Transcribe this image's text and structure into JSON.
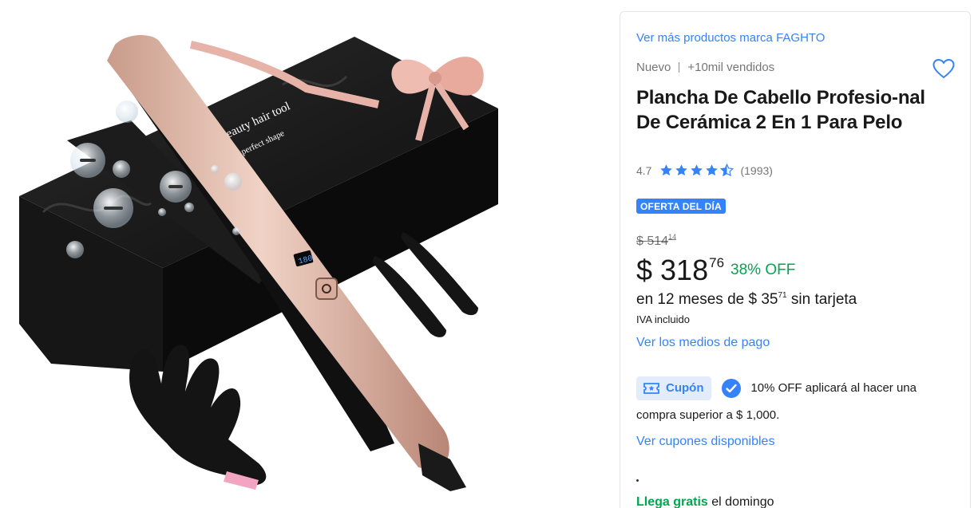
{
  "gallery": {
    "image_alt": "Plancha de cabello rosa con caja, guante térmico y pinzas",
    "box_text_1": "beauty hair tool",
    "box_text_2": "perfect shape",
    "display_value": "180"
  },
  "product": {
    "brand_link": "Ver más productos marca FAGHTO",
    "condition": "Nuevo",
    "sold": "+10mil vendidos",
    "title": "Plancha De Cabello Profesio-nal De Cerámica 2 En 1 Para Pelo",
    "rating_value": "4.7",
    "rating_stars": 4.7,
    "reviews_count": "(1993)",
    "deal_badge": "OFERTA DEL DÍA",
    "original_price_symbol": "$",
    "original_price_int": "514",
    "original_price_cents": "14",
    "price_symbol": "$",
    "price_int": "318",
    "price_cents": "76",
    "discount": "38% OFF",
    "installments_prefix": "en 12 meses de",
    "installments_amount": "$ 35",
    "installments_cents": "71",
    "installments_suffix": "sin tarjeta",
    "tax_note": "IVA incluido",
    "payment_link": "Ver los medios de pago",
    "coupon_label": "Cupón",
    "coupon_text_1": "10% OFF aplicará al hacer una",
    "coupon_text_2": "compra superior a $ 1,000.",
    "coupons_link": "Ver cupones disponibles",
    "shipping_free": "Llega gratis",
    "shipping_day": "el domingo"
  },
  "colors": {
    "accent": "#3483fa",
    "success": "#00a650"
  }
}
